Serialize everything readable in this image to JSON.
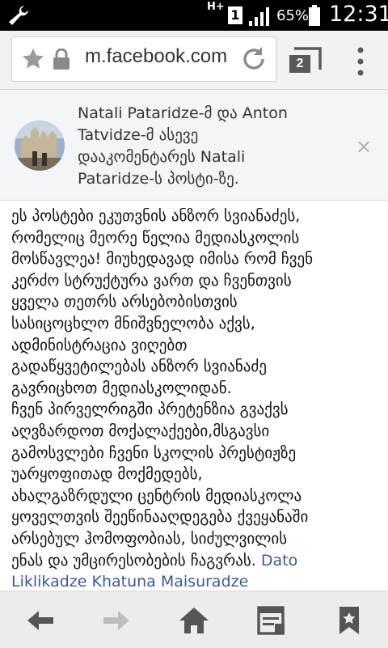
{
  "status_bar": {
    "network": "H+",
    "sim_slot": "1",
    "battery_percent": "65%",
    "time": "12:31",
    "icons": [
      "wrench-icon",
      "signal-icon",
      "battery-icon"
    ]
  },
  "browser": {
    "url": "m.facebook.com",
    "tab_count": "2",
    "icons": [
      "star-icon",
      "lock-icon",
      "reload-icon",
      "tabs-icon",
      "overflow-menu-icon"
    ]
  },
  "notification": {
    "text": "Natali Pataridze-მ და Anton Tatvidze-მ ასევე დააკომენტარეს Natali Pataridze-ს პოსტი-ზე.",
    "lines": [
      "Natali Pataridze-მ და Anton",
      "Tatvidze-მ ასევე",
      "დააკომენტარეს Natali",
      "Pataridze-ს პოსტი-ზე."
    ],
    "close_symbol": "×"
  },
  "article": {
    "lines": [
      "ეს პოსტები ეკუთვნის ანზორ სვიანაძეს,",
      "რომელიც მეორე წელია მედიასკოლის",
      "მოსწავლეა! მიუხედავად იმისა რომ ჩვენ",
      "კერძო სტრუქტურა ვართ და ჩვენთვის",
      "ყველა თეთრს არსებობისთვის",
      "სასიცოცხლო მნიშვნელობა აქვს,",
      "ადმინისტრაცია ვიღებთ",
      "გადაწყვეტილებას ანზორ სვიანაძე",
      "გავრიცხოთ მედიასკოლიდან.",
      "ჩვენ პირველრიგში პრეტენზია გვაქვს",
      "აღვზარდოთ მოქალაქეები,მსგავსი",
      "გამოსვლები ჩვენი სკოლის პრესტიჟზე",
      "უარყოფითად მოქმედებს,",
      "ახალგაზრდული ცენტრის მედიასკოლა",
      "ყოველთვის შეეწინააღდეგება ქვეყანაში",
      "არსებულ ჰომოფობიას, სიძულვილის",
      "ენას და უმცირესობების ჩაგვრას."
    ],
    "link_tail": "Dato",
    "link_next_line": "Liklikadze Khatuna Maisuradze"
  },
  "bottom_nav": {
    "icons": [
      "back-arrow-icon",
      "forward-arrow-icon",
      "home-icon",
      "reader-icon",
      "bookmark-icon"
    ]
  },
  "colors": {
    "link": "#3b5998",
    "notification_bg": "#f4f5f8",
    "chrome_bg": "#f2f2f2",
    "navbar_bg": "#ececec"
  }
}
